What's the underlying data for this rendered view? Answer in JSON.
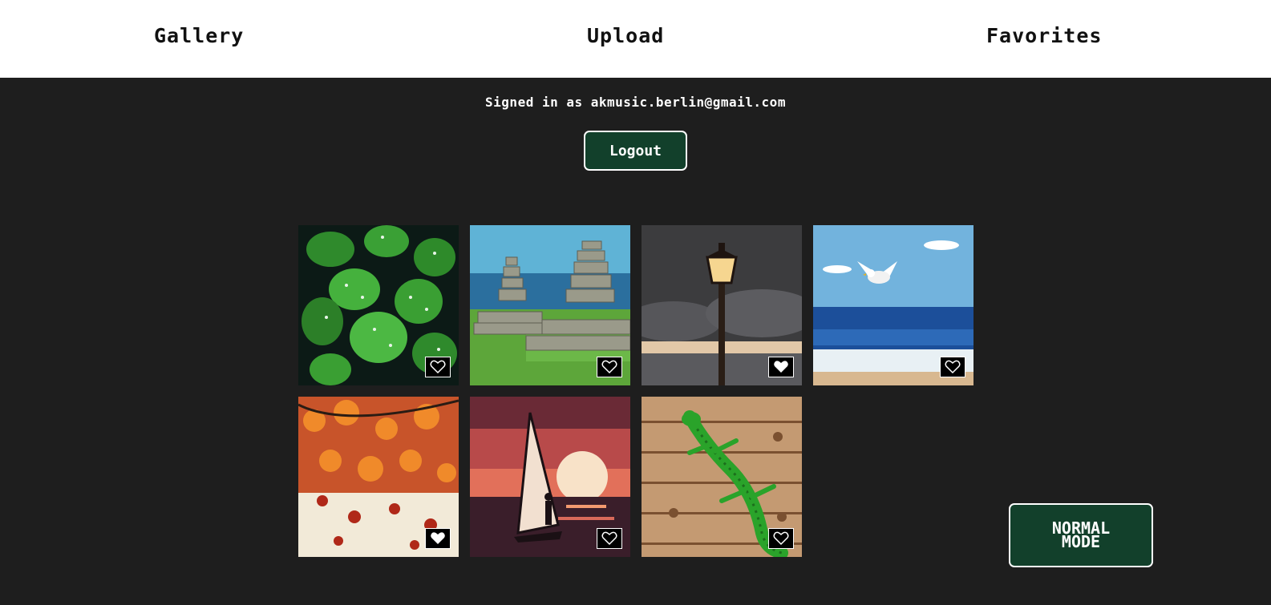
{
  "nav": {
    "gallery": "Gallery",
    "upload": "Upload",
    "favorites": "Favorites"
  },
  "account": {
    "signed_in_text": "Signed in as akmusic.berlin@gmail.com",
    "logout_label": "Logout"
  },
  "gallery": {
    "items": [
      {
        "subject": "green leaves with dew drops",
        "favorited": false
      },
      {
        "subject": "stacked stone cairns by the sea",
        "favorited": false
      },
      {
        "subject": "street lamp under stormy sky",
        "favorited": true
      },
      {
        "subject": "seagull over ocean waves",
        "favorited": false
      },
      {
        "subject": "autumn maple leaves",
        "favorited": true
      },
      {
        "subject": "windsurfer at sunset",
        "favorited": false
      },
      {
        "subject": "green gecko on wooden planks",
        "favorited": false
      }
    ]
  },
  "mode_toggle": {
    "label": "NORMAL MODE"
  },
  "colors": {
    "background": "#1e1e1e",
    "nav_background": "#ffffff",
    "button_green": "#12402b",
    "button_border": "#ffffff"
  }
}
